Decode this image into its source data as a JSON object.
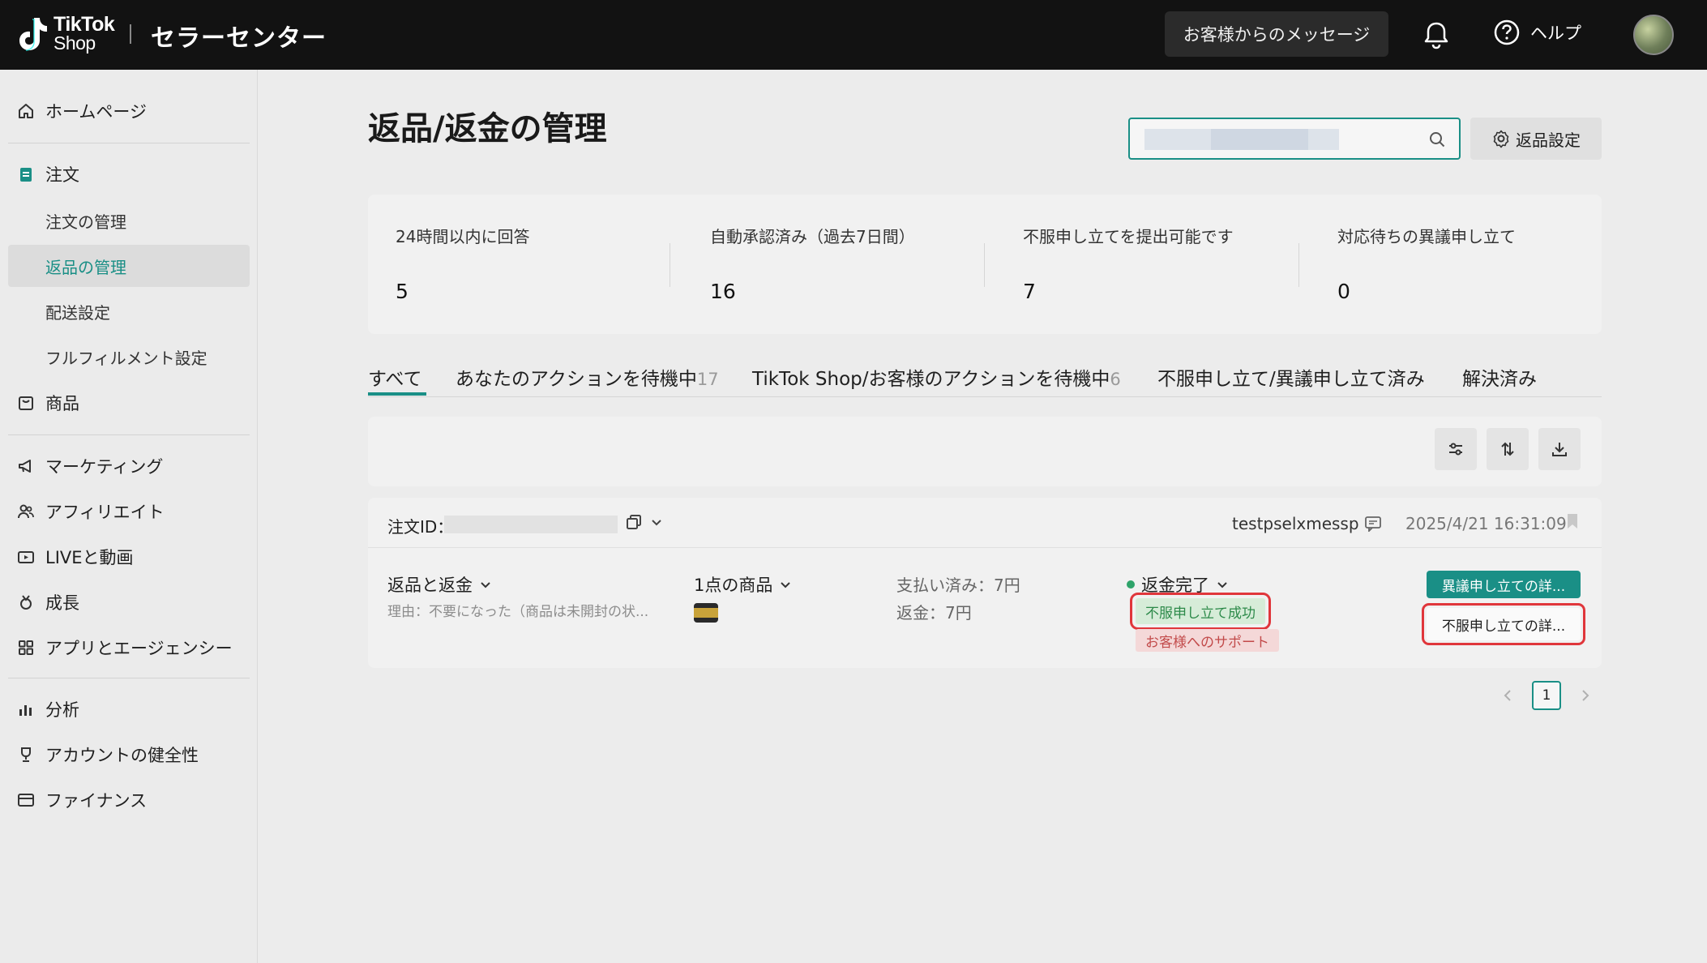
{
  "topbar": {
    "logo_line1": "TikTok",
    "logo_line2": "Shop",
    "title": "セラーセンター",
    "messages_label": "お客様からのメッセージ",
    "help_label": "ヘルプ"
  },
  "sidebar": {
    "home": "ホームページ",
    "orders": "注文",
    "order_mgmt": "注文の管理",
    "returns_mgmt": "返品の管理",
    "shipping": "配送設定",
    "fulfillment": "フルフィルメント設定",
    "products": "商品",
    "marketing": "マーケティング",
    "affiliate": "アフィリエイト",
    "live_video": "LIVEと動画",
    "growth": "成長",
    "apps": "アプリとエージェンシー",
    "analytics": "分析",
    "account_health": "アカウントの健全性",
    "finance": "ファイナンス"
  },
  "page": {
    "title": "返品/返金の管理",
    "return_settings": "返品設定"
  },
  "stats": [
    {
      "label": "24時間以内に回答",
      "value": "5"
    },
    {
      "label": "自動承認済み（過去7日間）",
      "value": "16"
    },
    {
      "label": "不服申し立てを提出可能です",
      "value": "7"
    },
    {
      "label": "対応待ちの異議申し立て",
      "value": "0"
    }
  ],
  "tabs": {
    "all": "すべて",
    "awaiting_you": "あなたのアクションを待機中",
    "awaiting_you_count": "17",
    "awaiting_shop": "TikTok Shop/お客様のアクションを待機中",
    "awaiting_shop_count": "6",
    "appealed": "不服申し立て/異議申し立て済み",
    "resolved": "解決済み"
  },
  "order": {
    "id_label": "注文ID：",
    "buyer": "testpselxmessp",
    "date": "2025/4/21 16:31:09",
    "type": "返品と返金",
    "reason": "理由：不要になった（商品は未開封の状...",
    "items": "1点の商品",
    "paid": "支払い済み：7円",
    "refund": "返金：7円",
    "status": "返金完了",
    "tag_appeal": "不服申し立て成功",
    "tag_support": "お客様へのサポート",
    "btn_dispute": "異議申し立ての詳...",
    "btn_appeal": "不服申し立ての詳..."
  },
  "pagination": {
    "current": "1"
  },
  "colors": {
    "accent": "#1a8f86",
    "highlight": "#e0363b",
    "topbar": "#121212"
  }
}
